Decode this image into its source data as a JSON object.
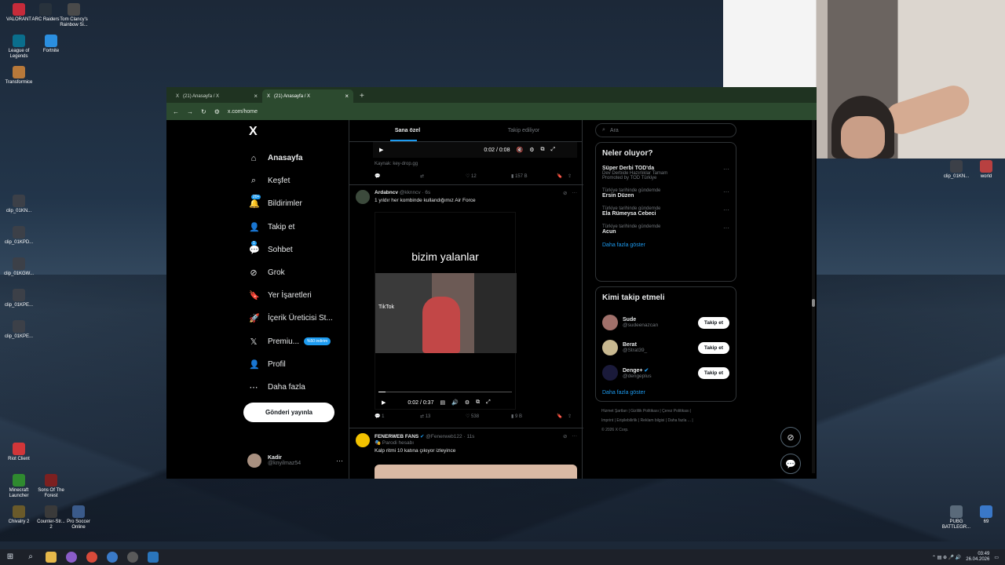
{
  "desktop": {
    "icons_left": [
      {
        "label": "VALORANT",
        "color": "#c62b3a"
      },
      {
        "label": "ARC Raiders",
        "color": "#28323c"
      },
      {
        "label": "Tom Clancy's Rainbow Si...",
        "color": "#4a4a4a"
      },
      {
        "label": "League of Legends",
        "color": "#0a6e8c"
      },
      {
        "label": "Fortnite",
        "color": "#2b8fe0"
      },
      {
        "label": "Transformice",
        "color": "#b8793a"
      },
      {
        "label": "clip_01KN...",
        "color": "#3c4048"
      },
      {
        "label": "clip_01KPD...",
        "color": "#3c4048"
      },
      {
        "label": "clip_01KGW...",
        "color": "#3c4048"
      },
      {
        "label": "clip_01KPE...",
        "color": "#3c4048"
      },
      {
        "label": "clip_01KPE...",
        "color": "#3c4048"
      },
      {
        "label": "Riot Client",
        "color": "#d13639"
      },
      {
        "label": "Minecraft Launcher",
        "color": "#2f8a2f"
      },
      {
        "label": "Sons Of The Forest",
        "color": "#7c2020"
      },
      {
        "label": "Chivalry 2",
        "color": "#6a5a2a"
      },
      {
        "label": "Counter-Str... 2",
        "color": "#3a3a3a"
      },
      {
        "label": "Pro Soccer Online",
        "color": "#3a5a8a"
      }
    ],
    "icons_right": [
      {
        "label": "clip_01KN...",
        "color": "#3c4048"
      },
      {
        "label": "world",
        "color": "#b84040"
      },
      {
        "label": "PUBG BATTLEGR...",
        "color": "#5a6a7a"
      },
      {
        "label": "69",
        "color": "#3a78c8"
      }
    ]
  },
  "browser": {
    "tabs": [
      {
        "title": "(21) Anasayfa / X",
        "active": false
      },
      {
        "title": "(21) Anasayfa / X",
        "active": true
      }
    ],
    "url": "x.com/home"
  },
  "nav": {
    "logo": "X",
    "items": [
      {
        "label": "Anasayfa",
        "icon": "home-icon",
        "glyph": "⌂",
        "bold": true
      },
      {
        "label": "Keşfet",
        "icon": "search-icon",
        "glyph": "⌕",
        "bold": false
      },
      {
        "label": "Bildirimler",
        "icon": "bell-icon",
        "glyph": "🔔",
        "bold": false,
        "badge": "20+"
      },
      {
        "label": "Takip et",
        "icon": "follow-icon",
        "glyph": "👤",
        "bold": false
      },
      {
        "label": "Sohbet",
        "icon": "chat-icon",
        "glyph": "💬",
        "bold": false,
        "badge": "1"
      },
      {
        "label": "Grok",
        "icon": "grok-icon",
        "glyph": "⊘",
        "bold": false
      },
      {
        "label": "Yer İşaretleri",
        "icon": "bookmark-icon",
        "glyph": "🔖",
        "bold": false
      },
      {
        "label": "İçerik Üreticisi St...",
        "icon": "rocket-icon",
        "glyph": "🚀",
        "bold": false
      },
      {
        "label": "Premiu...",
        "icon": "x-premium-icon",
        "glyph": "𝕏",
        "bold": false,
        "pill": "%50 indirim"
      },
      {
        "label": "Profil",
        "icon": "profile-icon",
        "glyph": "👤",
        "bold": false
      },
      {
        "label": "Daha fazla",
        "icon": "more-icon",
        "glyph": "⋯",
        "bold": false
      }
    ],
    "post_button": "Gönderi yayınla",
    "account": {
      "name": "Kadir",
      "handle": "@knyilmaz54",
      "more": "···"
    }
  },
  "feed": {
    "tabs": [
      "Sana özel",
      "Takip ediliyor"
    ],
    "post1": {
      "video_time": "0:02 / 0:08",
      "source": "Kaynak: key-drop.gg",
      "replies": "",
      "reposts": "",
      "likes": "12",
      "views": "157 B"
    },
    "post2": {
      "name": "Ardabncv",
      "handle": "@kknncv",
      "time": "· 6s",
      "text": "1 yıldır her kombinde kullandığımız Air Force",
      "video_title": "bizim yalanlar",
      "tiktok": "TikTok",
      "video_time": "0:02 / 0:37",
      "progress": 0.05,
      "replies": "1",
      "reposts": "13",
      "likes": "538",
      "views": "9 B"
    },
    "post3": {
      "name": "FENERWEB FANS",
      "handle": "@Fenerweb122",
      "time": "· 11s",
      "label": "Parodi hesabı",
      "text": "Kalp ritmi 10 katına çıkıyor izleyince"
    }
  },
  "sidebar": {
    "search_placeholder": "Ara",
    "trends_title": "Neler oluyor?",
    "trends": [
      {
        "category": "",
        "name": "Süper Derbi TOD'da",
        "sub": "Dev Derbide Hazırlıklar Tamam",
        "promoted": "Promoted by TOD Türkiye"
      },
      {
        "category": "Türkiye tarihinde gündemde",
        "name": "Ersin Düzen",
        "sub": "",
        "promoted": ""
      },
      {
        "category": "Türkiye tarihinde gündemde",
        "name": "Ela Rümeysa Cebeci",
        "sub": "",
        "promoted": ""
      },
      {
        "category": "Türkiye tarihinde gündemde",
        "name": "Acun",
        "sub": "",
        "promoted": ""
      }
    ],
    "show_more": "Daha fazla göster",
    "who_title": "Kimi takip etmeli",
    "who": [
      {
        "name": "Sude",
        "handle": "@sudeenazcan",
        "color": "#a0706a",
        "verified": false
      },
      {
        "name": "Berat",
        "handle": "@Strat39_",
        "color": "#c8b890",
        "verified": false
      },
      {
        "name": "Denge+",
        "handle": "@dengeplus",
        "color": "#1a1a3a",
        "verified": true
      }
    ],
    "follow_label": "Takip et",
    "who_more": "Daha fazla göster",
    "footer": [
      "Hizmet Şartları",
      "Gizlilik Politikası",
      "Çerez Politikası",
      "Imprint",
      "Erişilebilirlik",
      "Reklam bilgisi",
      "Daha fazla ...",
      "© 2026 X Corp."
    ]
  },
  "taskbar": {
    "time": "03:49",
    "date": "26.04.2026"
  }
}
